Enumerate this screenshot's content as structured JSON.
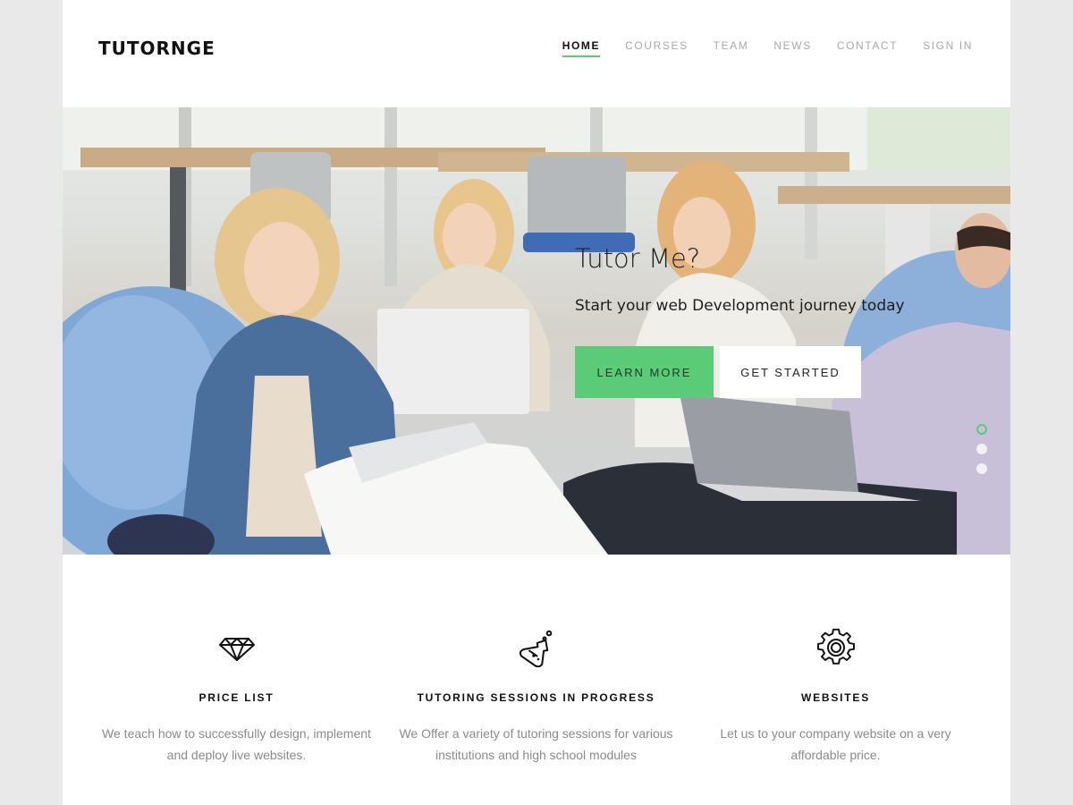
{
  "header": {
    "logo": "TUTORNGE",
    "nav": [
      "HOME",
      "COURSES",
      "TEAM",
      "NEWS",
      "CONTACT",
      "SIGN IN"
    ],
    "active_nav": "HOME",
    "accent_color": "#5acc78"
  },
  "hero": {
    "title": "Tutor Me?",
    "subtitle": "Start your web Development journey today",
    "learn_more_label": "LEARN MORE",
    "get_started_label": "GET STARTED",
    "slide_count": 3,
    "active_slide": 1
  },
  "features": [
    {
      "icon": "diamond-icon",
      "title": "PRICE LIST",
      "text1": "We teach how to successfully design, implement",
      "text2": "and deploy live websites."
    },
    {
      "icon": "flask-icon",
      "title": "TUTORING SESSIONS IN PROGRESS",
      "text1": "We Offer a variety of tutoring sessions for various",
      "text2": "institutions and high school modules"
    },
    {
      "icon": "gear-icon",
      "title": "WEBSITES",
      "text1": "Let us to your company website on a very",
      "text2": "affordable price."
    }
  ]
}
